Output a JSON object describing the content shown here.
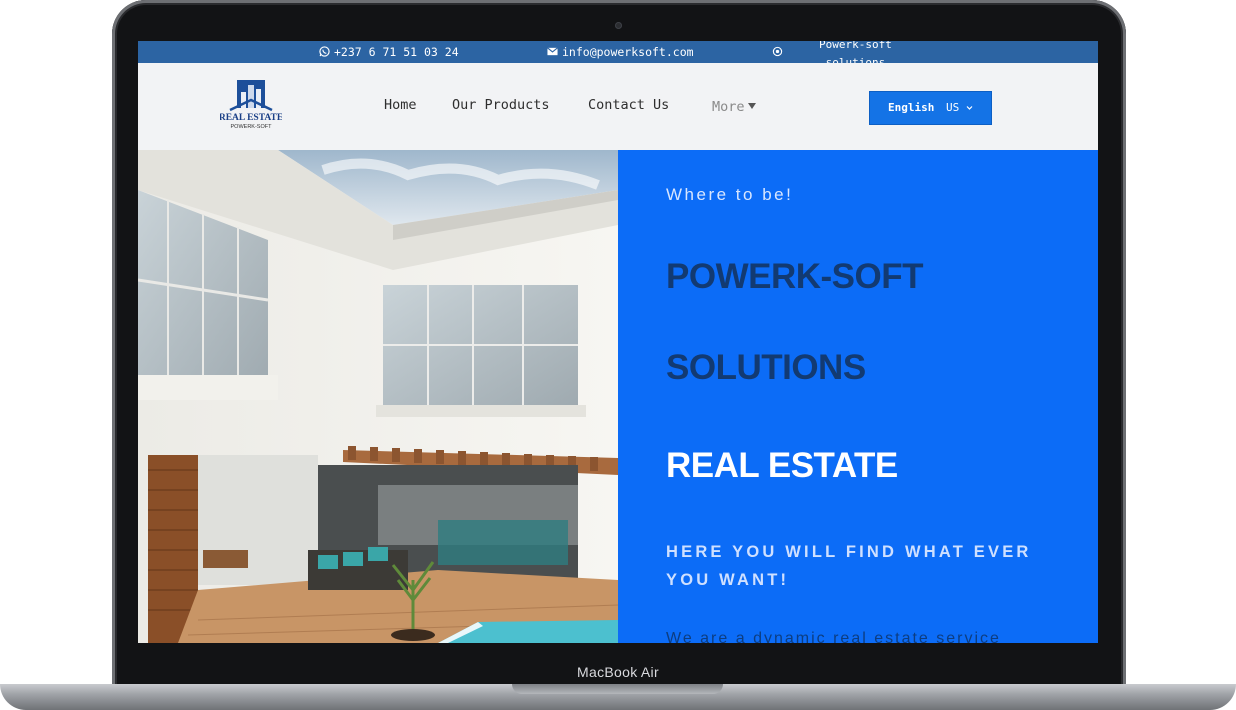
{
  "topbar": {
    "phone": "+237 6 71 51 03 24",
    "email": "info@powerksoft.com",
    "company_line1": "Powerk-soft",
    "company_line2": "solutions"
  },
  "logo": {
    "title": "REAL ESTATE",
    "subtitle": "POWERK-SOFT"
  },
  "nav": {
    "items": [
      "Home",
      "Our Products",
      "Contact Us"
    ],
    "more": "More"
  },
  "language": {
    "label": "English",
    "code": "US"
  },
  "hero": {
    "kicker": "Where to be!",
    "heading_line1": "POWERK-SOFT",
    "heading_line2": "SOLUTIONS",
    "heading_main": "REAL ESTATE",
    "tagline": "HERE YOU WILL FIND WHAT EVER YOU WANT!",
    "description": "We are a dynamic real estate service"
  },
  "device": {
    "label": "MacBook Air"
  },
  "colors": {
    "topbar": "#2c64a3",
    "accent": "#0c6cf7",
    "button": "#1473e6",
    "dark_heading": "#123a72"
  },
  "icons": [
    "whatsapp-icon",
    "mail-icon",
    "location-icon",
    "chevron-down-icon"
  ]
}
